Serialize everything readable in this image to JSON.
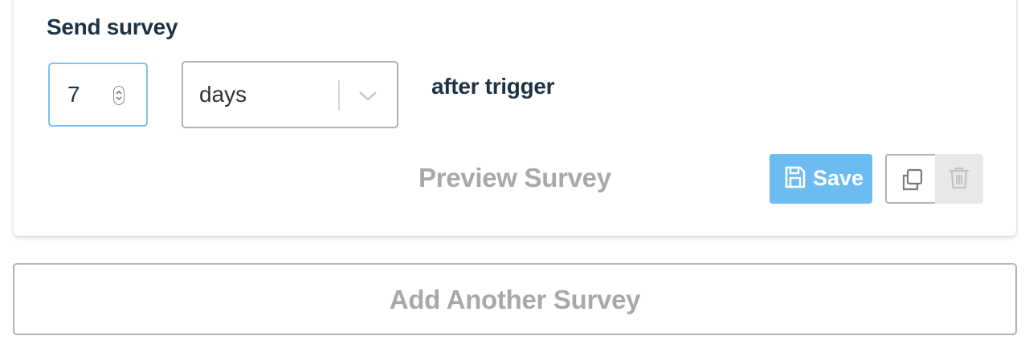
{
  "send_survey": {
    "heading": "Send survey",
    "delay_value": "7",
    "unit_selected": "days",
    "after_label": "after trigger"
  },
  "actions": {
    "preview_label": "Preview Survey",
    "save_label": "Save",
    "save_icon": "floppy-disk-icon",
    "duplicate_icon": "copy-icon",
    "delete_icon": "trash-icon"
  },
  "add_survey_label": "Add Another Survey",
  "colors": {
    "primary": "#6cbcf2",
    "focus_border": "#7cc3f5",
    "heading_text": "#1d3244",
    "muted_text": "#a8a8a8"
  }
}
